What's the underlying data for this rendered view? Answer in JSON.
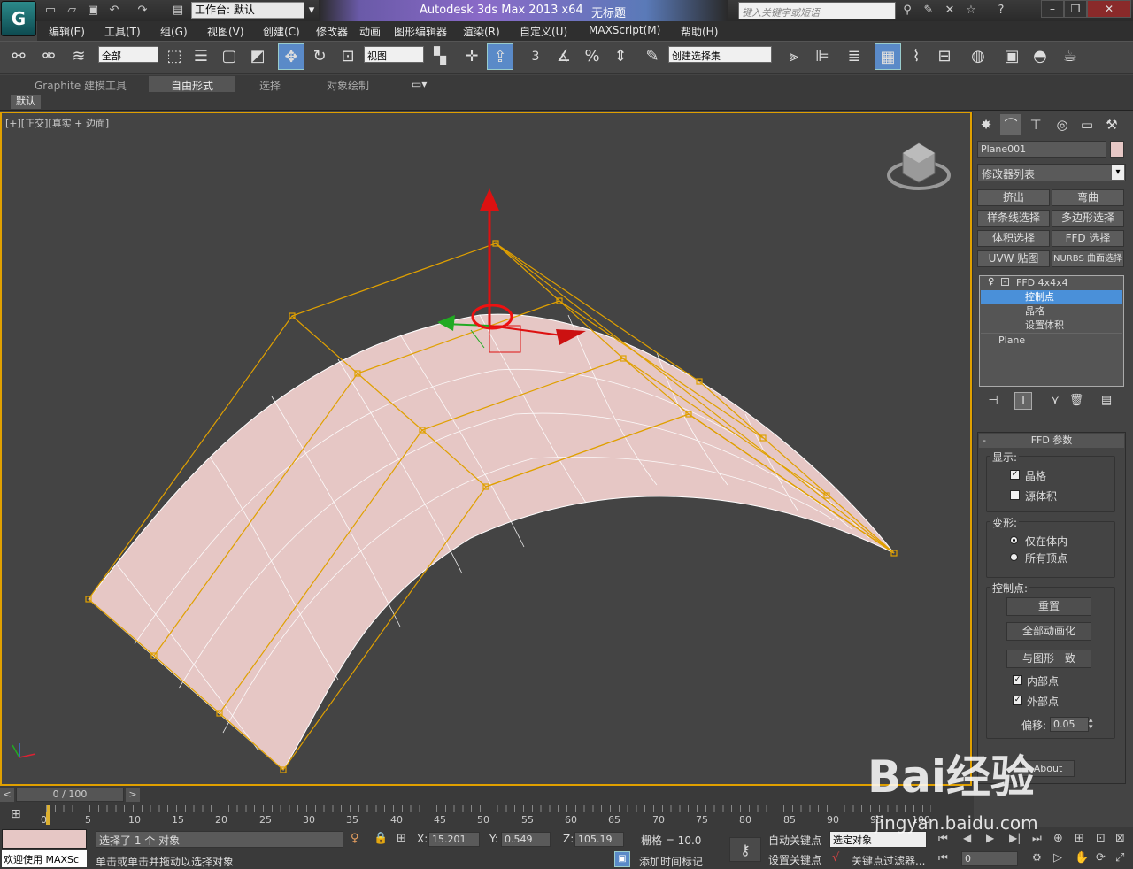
{
  "titlebar": {
    "workspace_label": "工作台: 默认",
    "app_title": "Autodesk 3ds Max  2013 x64",
    "doc_title": "无标题",
    "search_placeholder": "键入关键字或短语",
    "logo": "G"
  },
  "menu": [
    "编辑(E)",
    "工具(T)",
    "组(G)",
    "视图(V)",
    "创建(C)",
    "修改器",
    "动画",
    "图形编辑器",
    "渲染(R)",
    "自定义(U)",
    "MAXScript(M)",
    "帮助(H)"
  ],
  "toolbar": {
    "selection_filter": "全部",
    "ref_coord": "视图",
    "named_selection": "创建选择集",
    "snap_label": "3"
  },
  "ribbon": {
    "tabs": [
      "Graphite 建模工具",
      "自由形式",
      "选择",
      "对象绘制"
    ],
    "active_tab": "自由形式",
    "sub_label": "默认"
  },
  "viewport": {
    "label_prefix": "[+][正交][",
    "label_mode": "真实 + 边面",
    "label_suffix": "]",
    "mesh_color": "#e6c7c5",
    "lattice_color": "#e0a000"
  },
  "command_panel": {
    "object_name": "Plane001",
    "object_color": "#e6c7c5",
    "modifier_list": "修改器列表",
    "mod_buttons": [
      [
        "挤出",
        "弯曲"
      ],
      [
        "样条线选择",
        "多边形选择"
      ],
      [
        "体积选择",
        "FFD 选择"
      ],
      [
        "UVW 贴图",
        "NURBS 曲面选择"
      ]
    ],
    "stack": [
      {
        "label": "FFD 4x4x4",
        "selected": false
      },
      {
        "label": "控制点",
        "selected": true
      },
      {
        "label": "晶格",
        "selected": false
      },
      {
        "label": "设置体积",
        "selected": false
      },
      {
        "label": "Plane",
        "selected": false
      }
    ]
  },
  "ffd_params": {
    "title": "FFD 参数",
    "display_group": "显示:",
    "lattice": "晶格",
    "source_volume": "源体积",
    "deform_group": "变形:",
    "only_in_volume": "仅在体内",
    "all_vertices": "所有顶点",
    "cp_group": "控制点:",
    "reset": "重置",
    "animate_all": "全部动画化",
    "conform": "与图形一致",
    "inner": "内部点",
    "outer": "外部点",
    "offset_label": "偏移:",
    "offset_value": "0.05",
    "about": "About"
  },
  "timeline": {
    "frame": "0 / 100",
    "ticks": [
      "0",
      "5",
      "10",
      "15",
      "20",
      "25",
      "30",
      "35",
      "40",
      "45",
      "50",
      "55",
      "60",
      "65",
      "70",
      "75",
      "80",
      "85",
      "90",
      "95",
      "100"
    ]
  },
  "status": {
    "welcome": "欢迎使用  MAXSc",
    "selected": "选择了 1 个 对象",
    "prompt": "单击或单击并拖动以选择对象",
    "x_label": "X:",
    "x": "15.201",
    "y_label": "Y:",
    "y": "0.549",
    "z_label": "Z:",
    "z": "105.19",
    "grid": "栅格 = 10.0",
    "auto_key": "自动关键点",
    "set_key": "设置关键点",
    "key_mode": "选定对象",
    "key_filters": "关键点过滤器...",
    "add_time_tag": "添加时间标记",
    "frame_field": "0"
  },
  "watermark": {
    "text": "Bai经验",
    "url": "jingyan.baidu.com"
  }
}
